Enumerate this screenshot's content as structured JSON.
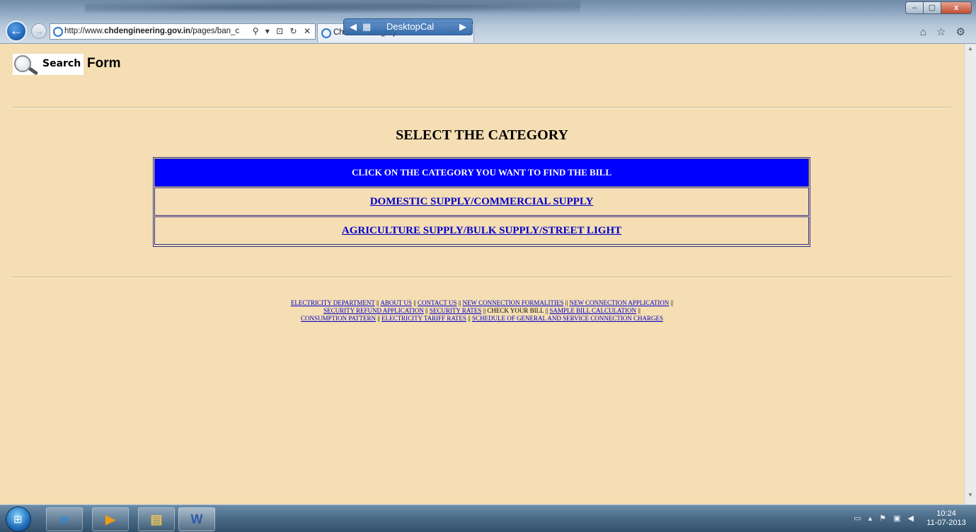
{
  "browser": {
    "url_prefix": "http://www.",
    "url_domain": "chdengineering.gov.in",
    "url_rest": "/pages/ban_c",
    "addr_controls": "⚲ ▾ ⊡ ↻ ✕",
    "tab_title": "Choose Category",
    "overlay_label": "DesktopCal",
    "toolbar_icons": "⌂ ☆ ⚙",
    "win_minimize": "–",
    "win_maximize": "▢",
    "win_close": "x"
  },
  "page": {
    "logo_word": "Search",
    "title": "Form",
    "heading": "SELECT THE CATEGORY",
    "table_header": "CLICK ON THE CATEGORY YOU WANT TO FIND THE BILL",
    "categories": [
      "DOMESTIC SUPPLY/COMMERCIAL SUPPLY",
      "AGRICULTURE SUPPLY/BULK SUPPLY/STREET LIGHT"
    ]
  },
  "footer": {
    "links": [
      "ELECTRICITY DEPARTMENT",
      "ABOUT US",
      "CONTACT US",
      "NEW CONNECTION FORMALITIES",
      "NEW CONNECTION APPLICATION",
      "SECURITY REFUND APPLICATION",
      "SECURITY RATES",
      "CHECK YOUR BILL",
      "SAMPLE BILL CALCULATION",
      "CONSUMPTION PATTERN",
      "ELECTRICITY TARIFF RATES",
      "SCHEDULE OF GENERAL AND SERVICE CONNECTION CHARGES"
    ],
    "separator": "||"
  },
  "taskbar": {
    "apps": [
      "internet-explorer",
      "media-player",
      "file-explorer",
      "word"
    ],
    "clock_time": "10:24",
    "clock_date": "11-07-2013"
  },
  "colors": {
    "page_background": "#f5deb3",
    "header_row": "#0000ff",
    "link": "#0000cc"
  }
}
